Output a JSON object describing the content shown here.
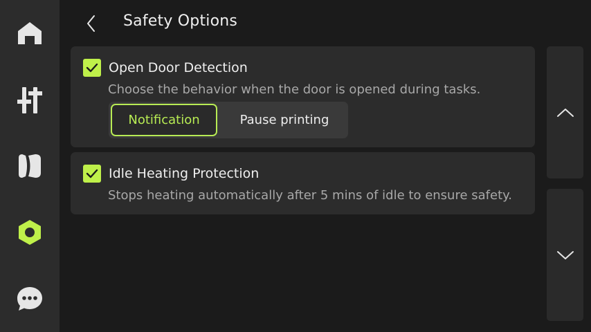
{
  "header": {
    "title": "Safety Options"
  },
  "sidebar": {
    "items": [
      {
        "icon": "home-icon"
      },
      {
        "icon": "controls-icon"
      },
      {
        "icon": "filament-icon"
      },
      {
        "icon": "settings-icon",
        "active": true
      },
      {
        "icon": "chat-icon"
      }
    ]
  },
  "cards": [
    {
      "label": "Open Door Detection",
      "checked": true,
      "description": "Choose the behavior when the door is opened during tasks.",
      "options": [
        "Notification",
        "Pause printing"
      ],
      "selected": "Notification"
    },
    {
      "label": "Idle Heating Protection",
      "checked": true,
      "description": "Stops heating automatically after 5 mins of idle to ensure safety."
    }
  ],
  "colors": {
    "accent": "#bff04a",
    "sidebar_bg": "#2c2c2c",
    "page_bg": "#1b1b1b",
    "icon_inactive": "#e6e6e6"
  }
}
